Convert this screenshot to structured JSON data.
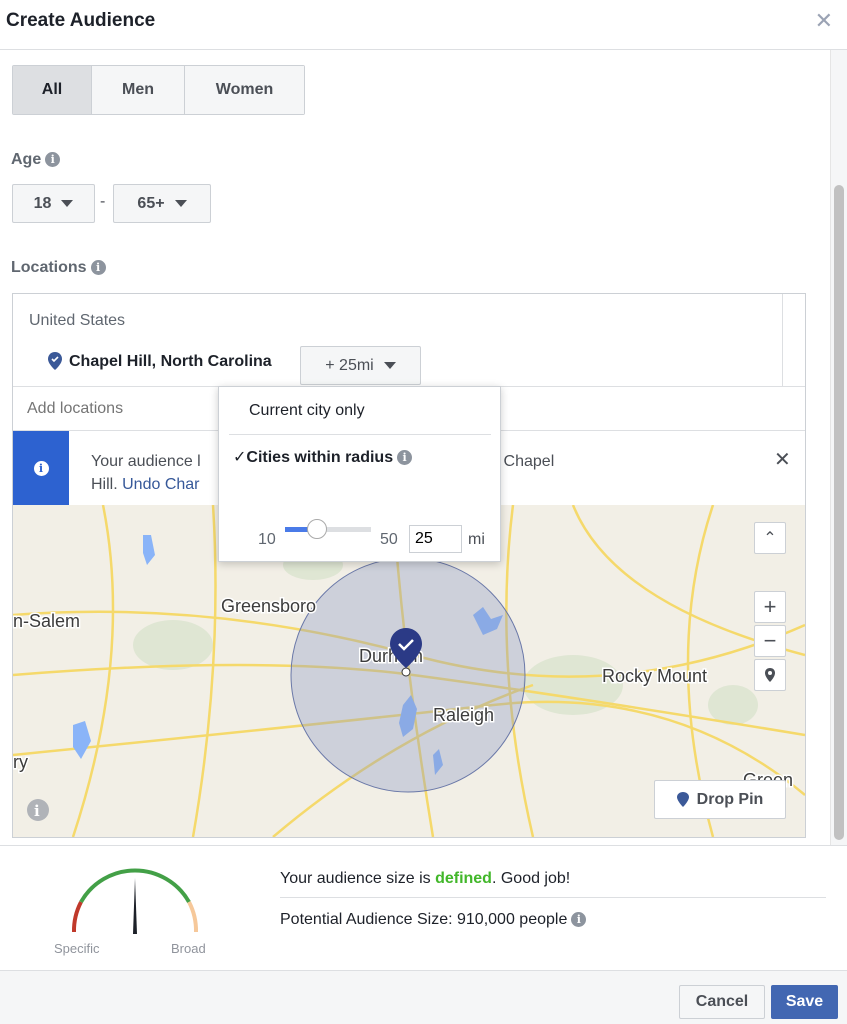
{
  "header": {
    "title": "Create Audience",
    "close_icon": "close-icon"
  },
  "gender": {
    "options": [
      "All",
      "Men",
      "Women"
    ],
    "selected": "All"
  },
  "age": {
    "label": "Age",
    "min": "18",
    "max": "65+",
    "separator": "-"
  },
  "locations": {
    "label": "Locations",
    "country": "United States",
    "city": "Chapel Hill, North Carolina",
    "radius_button": "+ 25mi",
    "add_placeholder": "Add locations",
    "banner": {
      "text_start": "Your audience l",
      "text_end": "ited States to Chapel",
      "text_line2": "Hill.",
      "link": "Undo Char"
    },
    "popup": {
      "option1": "Current city only",
      "option2": "Cities within radius",
      "check": "✓",
      "slider_min": "10",
      "slider_max": "50",
      "slider_value": 25,
      "radius_value": "25",
      "unit": "mi"
    },
    "map": {
      "labels": [
        "Greensboro",
        "n-Salem",
        "Durham",
        "Raleigh",
        "Rocky Mount",
        "ry",
        "Green"
      ],
      "drop_pin": "Drop Pin"
    }
  },
  "audience": {
    "gauge_left": "Specific",
    "gauge_right": "Broad",
    "status_prefix": "Your audience size is ",
    "status_word": "defined",
    "status_suffix": ". Good job!",
    "size_text": "Potential Audience Size: 910,000 people",
    "colors": {
      "defined": "#42b72a",
      "specific": "#c0392b",
      "good": "#43a047",
      "broad": "#f6c89a"
    }
  },
  "footer": {
    "cancel": "Cancel",
    "save": "Save",
    "save_color": "#4267b2"
  }
}
